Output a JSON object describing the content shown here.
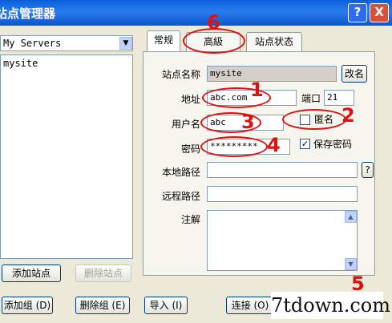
{
  "window": {
    "title": "站点管理器",
    "help_label": "?",
    "close_label": "X"
  },
  "sidebar": {
    "combo_value": "My Servers",
    "sites": [
      "mysite"
    ],
    "add_site_label": "添加站点",
    "delete_site_label": "删除站点"
  },
  "tabs": [
    {
      "label": "常规"
    },
    {
      "label": "高級"
    },
    {
      "label": "站点状态"
    }
  ],
  "form": {
    "site_name_label": "站点名称",
    "site_name_value": "mysite",
    "rename_label": "改名",
    "address_label": "地址",
    "address_value": "abc.com",
    "port_label": "端口",
    "port_value": "21",
    "username_label": "用户名",
    "username_value": "abc",
    "anonymous_label": "匿名",
    "password_label": "密码",
    "password_value": "*********",
    "save_password_label": "保存密码",
    "local_path_label": "本地路径",
    "local_path_browse": "?",
    "remote_path_label": "远程路径",
    "notes_label": "注解"
  },
  "bottom": {
    "add_group_label": "添加组 (D)",
    "delete_group_label": "删除组 (E)",
    "import_label": "导入 (I)",
    "connect_label": "连接 (O)"
  },
  "annotations": [
    "1",
    "2",
    "3",
    "4",
    "5",
    "6"
  ],
  "watermark": "7tdown.com",
  "colors": {
    "titlebar": "#0a5fd8",
    "face": "#ece9d8",
    "annotation": "#e01010"
  }
}
